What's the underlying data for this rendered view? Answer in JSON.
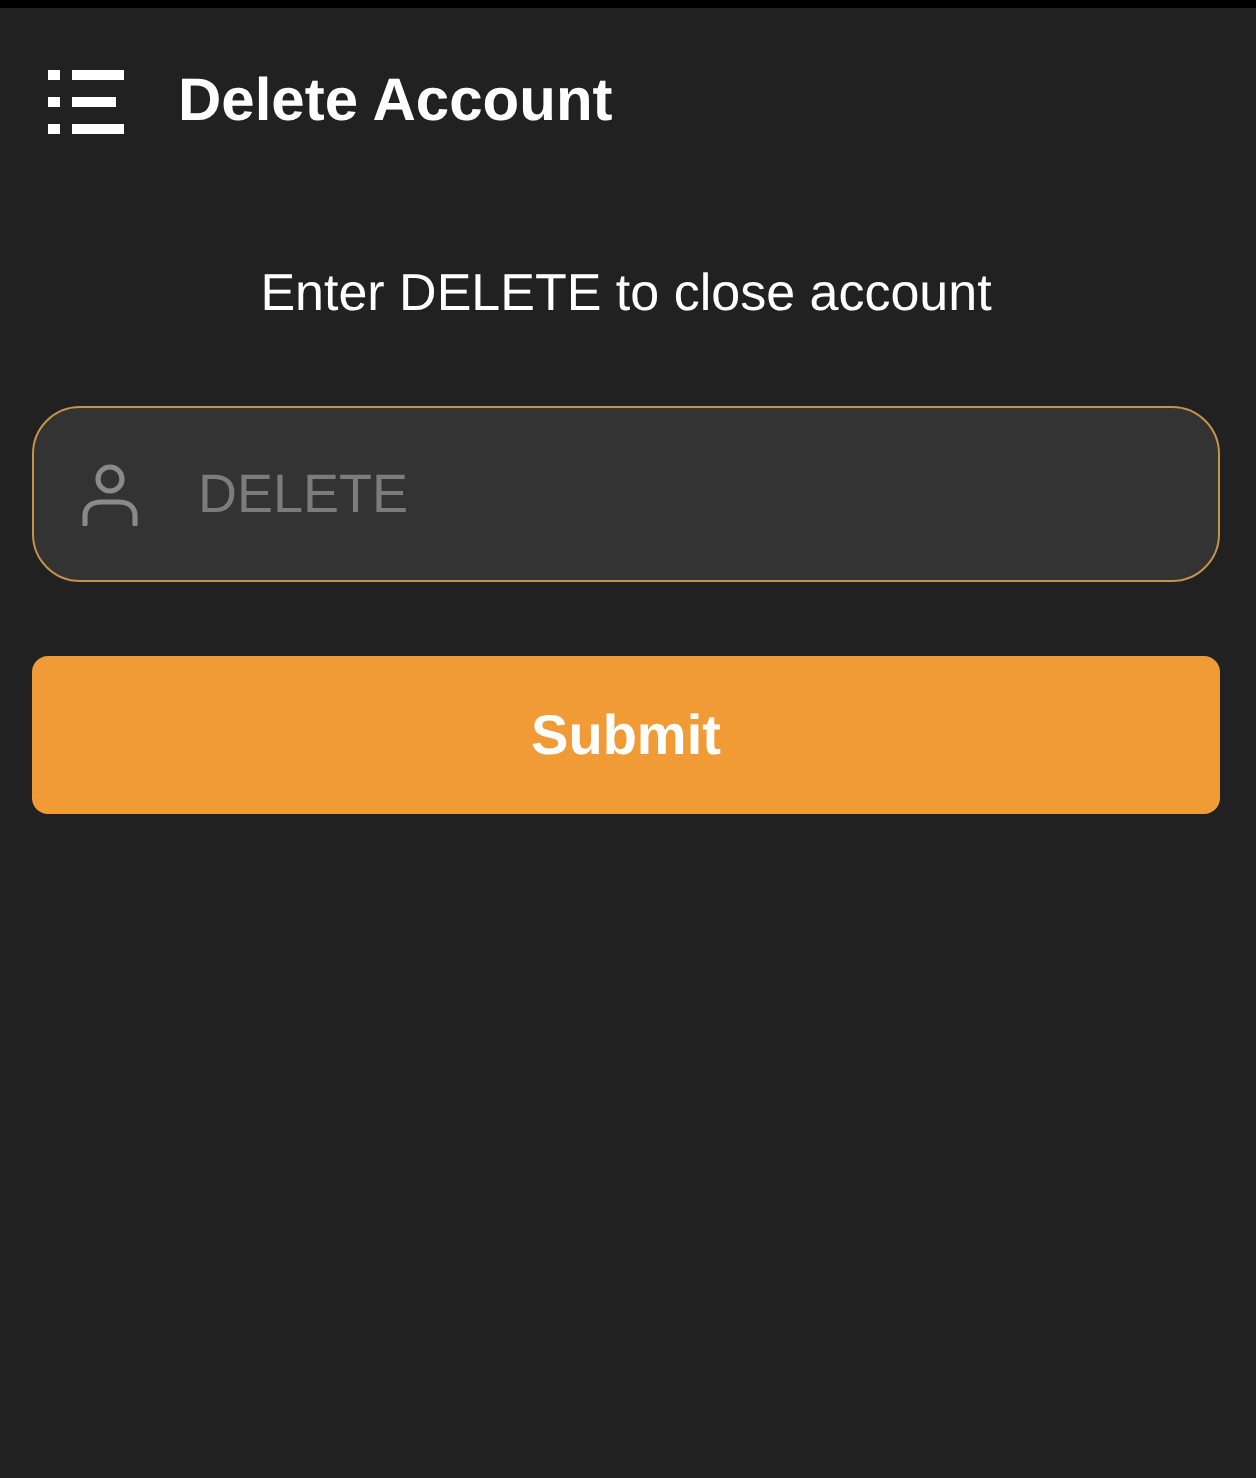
{
  "header": {
    "title": "Delete Account"
  },
  "instruction": "Enter DELETE to close account",
  "confirm_field": {
    "placeholder": "DELETE"
  },
  "submit_button": {
    "label": "Submit"
  }
}
